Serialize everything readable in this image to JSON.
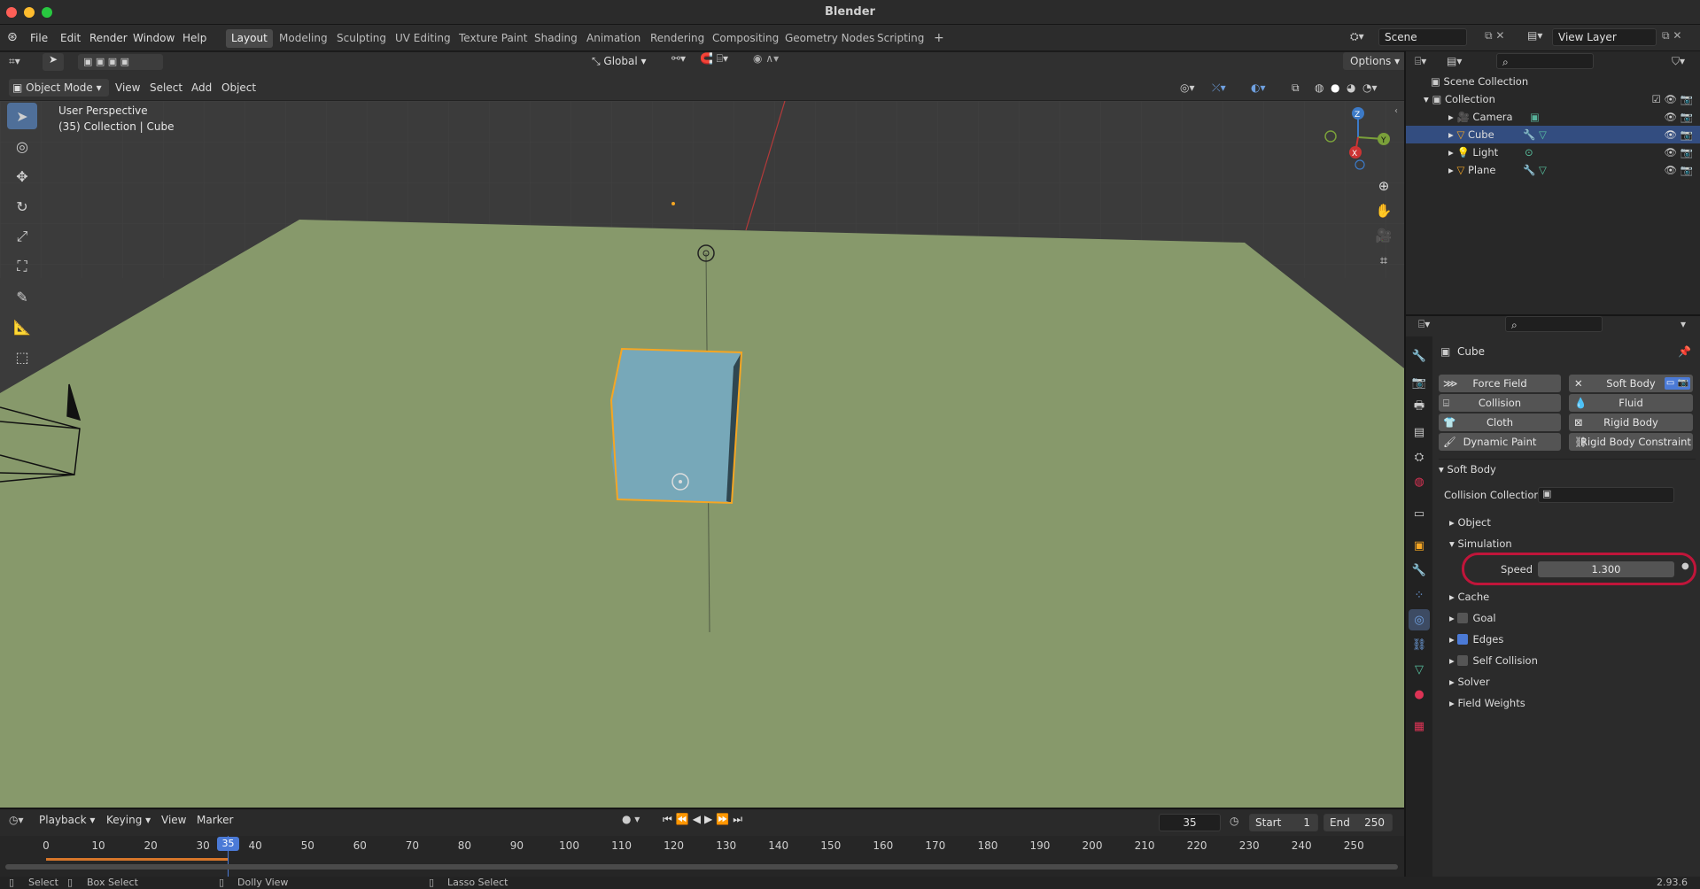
{
  "window": {
    "title": "Blender"
  },
  "menu": [
    "File",
    "Edit",
    "Render",
    "Window",
    "Help"
  ],
  "workspaces": [
    "Layout",
    "Modeling",
    "Sculpting",
    "UV Editing",
    "Texture Paint",
    "Shading",
    "Animation",
    "Rendering",
    "Compositing",
    "Geometry Nodes",
    "Scripting"
  ],
  "active_workspace": "Layout",
  "scene": {
    "name": "Scene",
    "view_layer": "View Layer"
  },
  "viewport": {
    "transform_orientation": "Global",
    "options_label": "Options",
    "mode": "Object Mode",
    "menu": [
      "View",
      "Select",
      "Add",
      "Object"
    ],
    "overlay_line1": "User Perspective",
    "overlay_line2": "(35) Collection | Cube",
    "gizmo": {
      "z": "Z",
      "y": "Y",
      "x": "X"
    }
  },
  "outliner": {
    "root": "Scene Collection",
    "collection": "Collection",
    "items": [
      {
        "name": "Camera",
        "selected": false
      },
      {
        "name": "Cube",
        "selected": true
      },
      {
        "name": "Light",
        "selected": false
      },
      {
        "name": "Plane",
        "selected": false
      }
    ]
  },
  "properties": {
    "object_name": "Cube",
    "physics_buttons": [
      "Force Field",
      "Soft Body",
      "Collision",
      "Fluid",
      "Cloth",
      "Rigid Body",
      "Dynamic Paint",
      "Rigid Body Constraint"
    ],
    "panel_title": "Soft Body",
    "collision_collection_label": "Collision Collection",
    "sub_object": "Object",
    "sub_simulation": "Simulation",
    "speed_label": "Speed",
    "speed_value": "1.300",
    "sections": [
      "Cache",
      "Goal",
      "Edges",
      "Self Collision",
      "Solver",
      "Field Weights"
    ],
    "checked": {
      "Goal": false,
      "Edges": true,
      "Self Collision": false
    }
  },
  "timeline": {
    "menu": [
      "Playback",
      "Keying",
      "View",
      "Marker"
    ],
    "current_frame": "35",
    "start_label": "Start",
    "start": "1",
    "end_label": "End",
    "end": "250",
    "ticks": [
      "0",
      "10",
      "20",
      "30",
      "40",
      "50",
      "60",
      "70",
      "80",
      "90",
      "100",
      "110",
      "120",
      "130",
      "140",
      "150",
      "160",
      "170",
      "180",
      "190",
      "200",
      "210",
      "220",
      "230",
      "240",
      "250"
    ]
  },
  "statusbar": {
    "select": "Select",
    "box_select": "Box Select",
    "dolly_view": "Dolly View",
    "lasso_select": "Lasso Select",
    "version": "2.93.6"
  }
}
